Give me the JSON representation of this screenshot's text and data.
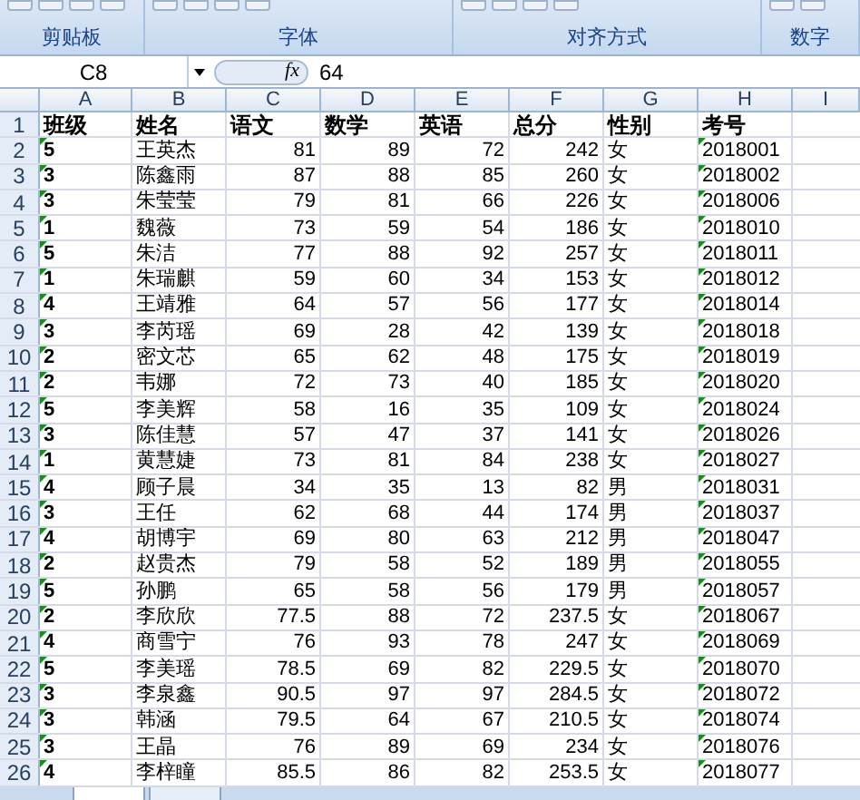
{
  "ribbon": {
    "groups": [
      "剪贴板",
      "字体",
      "对齐方式",
      "数字"
    ]
  },
  "formula_bar": {
    "name_box": "C8",
    "fx": "fx",
    "value": "64"
  },
  "sheet": {
    "columns": [
      "A",
      "B",
      "C",
      "D",
      "E",
      "F",
      "G",
      "H",
      "I"
    ],
    "rows": [
      {
        "number": "1",
        "cells": [
          "班级",
          "姓名",
          "语文",
          "数学",
          "英语",
          "总分",
          "性别",
          "考号"
        ]
      },
      {
        "number": "2",
        "cells": [
          "5",
          "王英杰",
          "81",
          "89",
          "72",
          "242",
          "女",
          "2018001"
        ]
      },
      {
        "number": "3",
        "cells": [
          "3",
          "陈鑫雨",
          "87",
          "88",
          "85",
          "260",
          "女",
          "2018002"
        ]
      },
      {
        "number": "4",
        "cells": [
          "3",
          "朱莹莹",
          "79",
          "81",
          "66",
          "226",
          "女",
          "2018006"
        ]
      },
      {
        "number": "5",
        "cells": [
          "1",
          "魏薇",
          "73",
          "59",
          "54",
          "186",
          "女",
          "2018010"
        ]
      },
      {
        "number": "6",
        "cells": [
          "5",
          "朱洁",
          "77",
          "88",
          "92",
          "257",
          "女",
          "2018011"
        ]
      },
      {
        "number": "7",
        "cells": [
          "1",
          "朱瑞麒",
          "59",
          "60",
          "34",
          "153",
          "女",
          "2018012"
        ]
      },
      {
        "number": "8",
        "cells": [
          "4",
          "王靖雅",
          "64",
          "57",
          "56",
          "177",
          "女",
          "2018014"
        ]
      },
      {
        "number": "9",
        "cells": [
          "3",
          "李芮瑶",
          "69",
          "28",
          "42",
          "139",
          "女",
          "2018018"
        ]
      },
      {
        "number": "10",
        "cells": [
          "2",
          "密文芯",
          "65",
          "62",
          "48",
          "175",
          "女",
          "2018019"
        ]
      },
      {
        "number": "11",
        "cells": [
          "2",
          "韦娜",
          "72",
          "73",
          "40",
          "185",
          "女",
          "2018020"
        ]
      },
      {
        "number": "12",
        "cells": [
          "5",
          "李美辉",
          "58",
          "16",
          "35",
          "109",
          "女",
          "2018024"
        ]
      },
      {
        "number": "13",
        "cells": [
          "3",
          "陈佳慧",
          "57",
          "47",
          "37",
          "141",
          "女",
          "2018026"
        ]
      },
      {
        "number": "14",
        "cells": [
          "1",
          "黄慧婕",
          "73",
          "81",
          "84",
          "238",
          "女",
          "2018027"
        ]
      },
      {
        "number": "15",
        "cells": [
          "4",
          "顾子晨",
          "34",
          "35",
          "13",
          "82",
          "男",
          "2018031"
        ]
      },
      {
        "number": "16",
        "cells": [
          "3",
          "王任",
          "62",
          "68",
          "44",
          "174",
          "男",
          "2018037"
        ]
      },
      {
        "number": "17",
        "cells": [
          "4",
          "胡博宇",
          "69",
          "80",
          "63",
          "212",
          "男",
          "2018047"
        ]
      },
      {
        "number": "18",
        "cells": [
          "2",
          "赵贵杰",
          "79",
          "58",
          "52",
          "189",
          "男",
          "2018055"
        ]
      },
      {
        "number": "19",
        "cells": [
          "5",
          "孙鹏",
          "65",
          "58",
          "56",
          "179",
          "男",
          "2018057"
        ]
      },
      {
        "number": "20",
        "cells": [
          "2",
          "李欣欣",
          "77.5",
          "88",
          "72",
          "237.5",
          "女",
          "2018067"
        ]
      },
      {
        "number": "21",
        "cells": [
          "4",
          "商雪宁",
          "76",
          "93",
          "78",
          "247",
          "女",
          "2018069"
        ]
      },
      {
        "number": "22",
        "cells": [
          "5",
          "李美瑶",
          "78.5",
          "69",
          "82",
          "229.5",
          "女",
          "2018070"
        ]
      },
      {
        "number": "23",
        "cells": [
          "3",
          "李泉鑫",
          "90.5",
          "97",
          "97",
          "284.5",
          "女",
          "2018072"
        ]
      },
      {
        "number": "24",
        "cells": [
          "3",
          "韩涵",
          "79.5",
          "64",
          "67",
          "210.5",
          "女",
          "2018074"
        ]
      },
      {
        "number": "25",
        "cells": [
          "3",
          "王晶",
          "76",
          "89",
          "69",
          "234",
          "女",
          "2018076"
        ]
      },
      {
        "number": "26",
        "cells": [
          "4",
          "李梓瞳",
          "85.5",
          "86",
          "82",
          "253.5",
          "女",
          "2018077"
        ]
      }
    ]
  }
}
